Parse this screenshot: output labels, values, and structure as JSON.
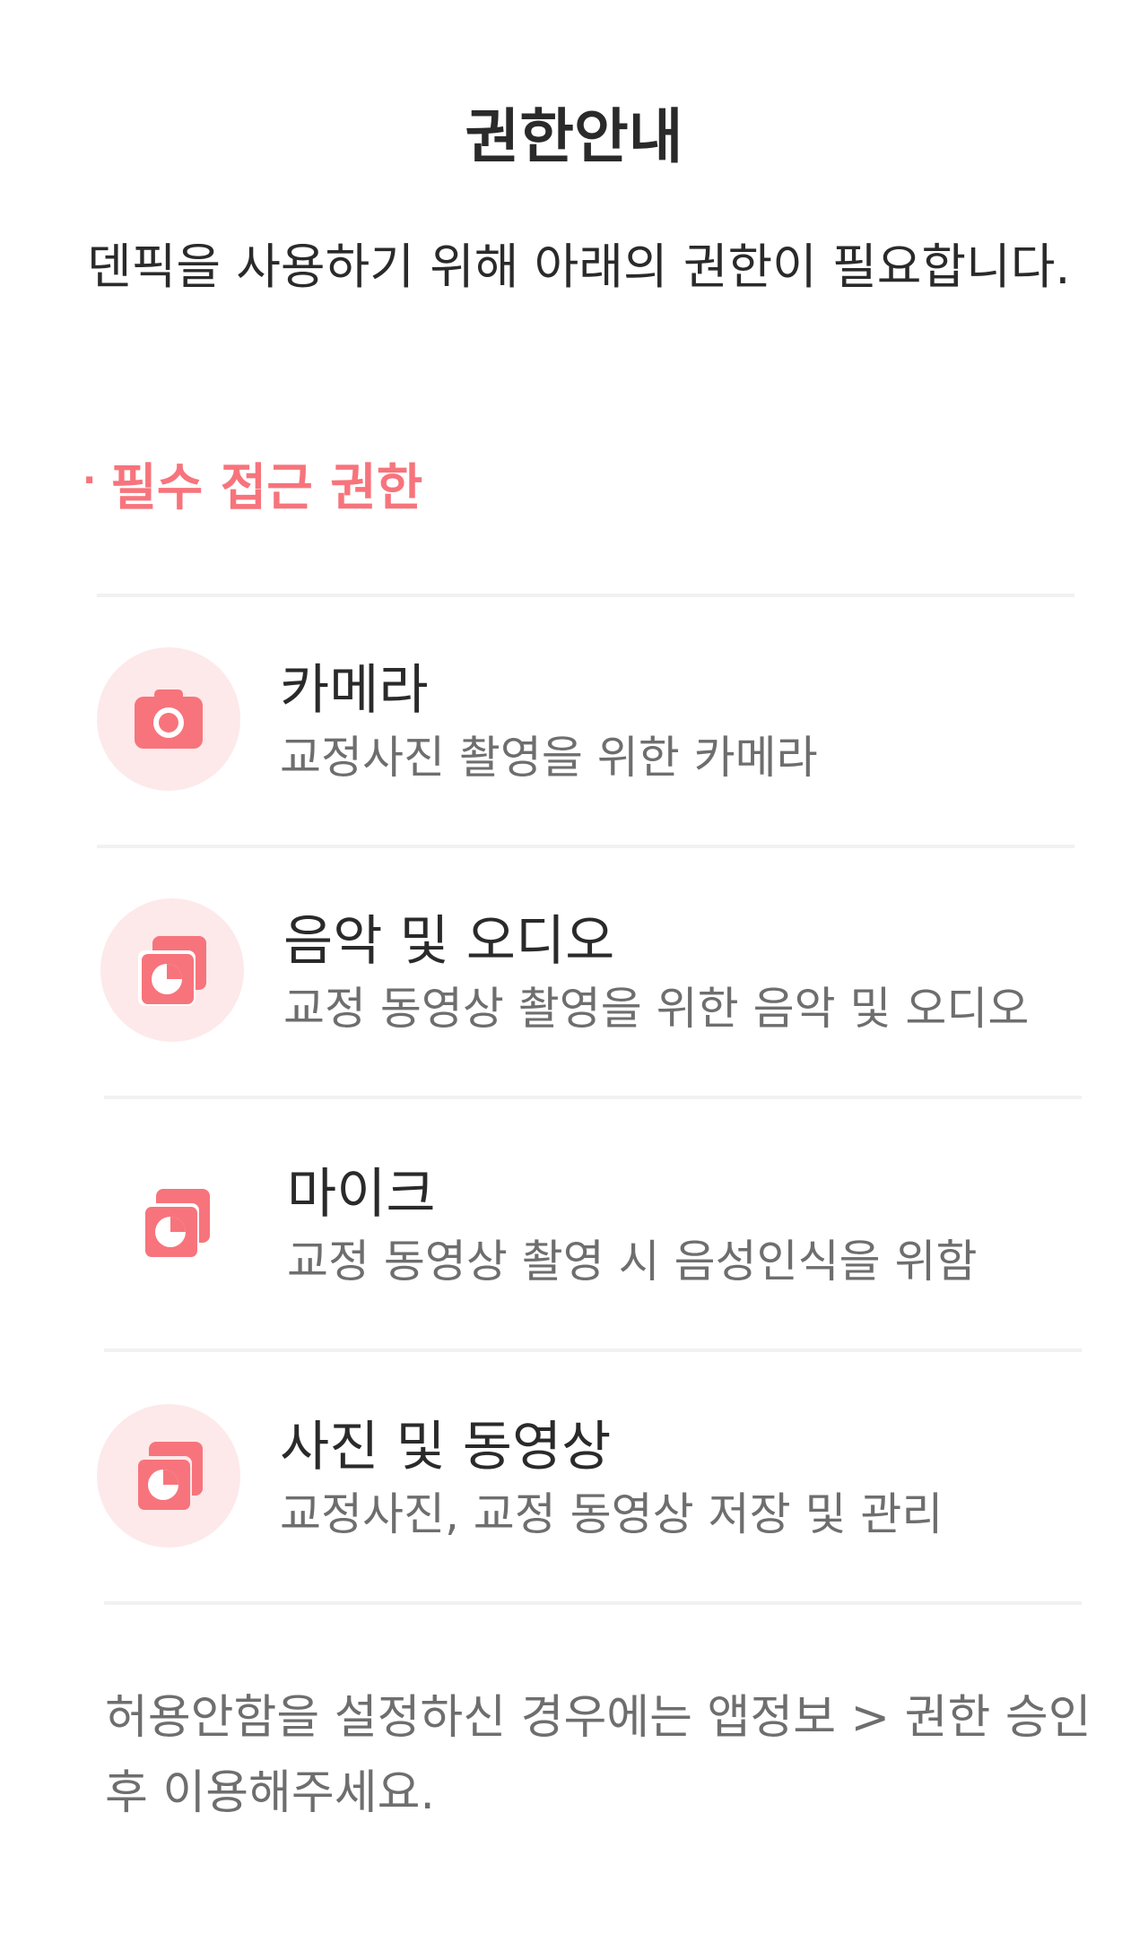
{
  "header": {
    "title": "권한안내"
  },
  "intro": {
    "text": "덴픽을 사용하기 위해 아래의 권한이 필요합니다."
  },
  "section": {
    "bullet": "·",
    "label": "필수 접근 권한"
  },
  "permissions": [
    {
      "icon": "camera-icon",
      "title": "카메라",
      "subtitle": "교정사진 촬영을 위한 카메라"
    },
    {
      "icon": "media-icon",
      "title": "음악 및 오디오",
      "subtitle": "교정 동영상 촬영을 위한 음악 및 오디오"
    },
    {
      "icon": "media-icon",
      "title": "마이크",
      "subtitle": "교정 동영상 촬영 시 음성인식을 위함"
    },
    {
      "icon": "media-icon",
      "title": "사진 및 동영상",
      "subtitle": "교정사진, 교정 동영상 저장 및 관리"
    }
  ],
  "footer": {
    "text": "허용안함을 설정하신 경우에는 앱정보 > 권한 승인 후 이용해주세요."
  },
  "colors": {
    "accent": "#f7747c",
    "icon_bg": "#fde9ea",
    "icon_fg": "#f7747c"
  }
}
